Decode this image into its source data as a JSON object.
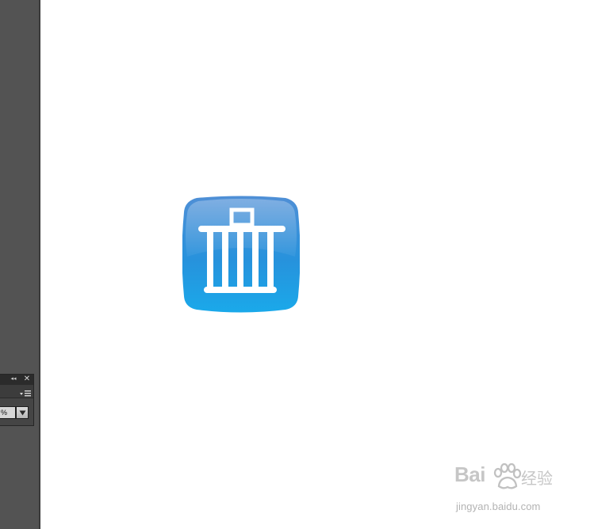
{
  "workspace": {
    "background_color": "#ffffff",
    "panel_color": "#535353"
  },
  "mini_panel": {
    "collapse_icon": "double-chevron-left-icon",
    "collapse_glyph": "◂◂",
    "close_icon": "close-icon",
    "close_glyph": "✕",
    "menu_icon": "panel-menu-icon",
    "opacity_value": "%",
    "dropdown_icon": "triangle-down-icon"
  },
  "canvas": {
    "artwork": {
      "icon": "trash-can-icon",
      "fill_top": "#4f8fd6",
      "fill_bottom": "#1aa9ea",
      "glyph_color": "#ffffff"
    }
  },
  "watermark": {
    "brand": "Bai",
    "brand_icon": "paw-icon",
    "product": "经验",
    "url": "jingyan.baidu.com"
  }
}
